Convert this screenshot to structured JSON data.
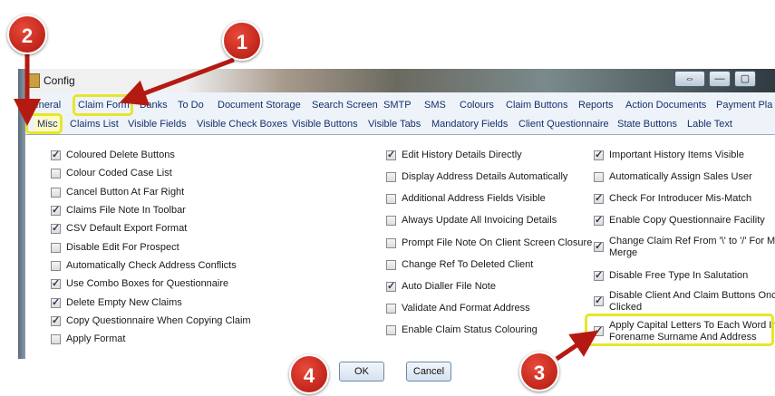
{
  "window": {
    "title": "Config",
    "restore_glyph": "⇔",
    "min_glyph": "—",
    "max_glyph": "▢"
  },
  "tabs_row1": [
    "General",
    "Claim Form",
    "Banks",
    "To Do",
    "Document Storage",
    "Search Screen",
    "SMTP",
    "SMS",
    "Colours",
    "Claim Buttons",
    "Reports",
    "Action Documents",
    "Payment Pla"
  ],
  "tabs_row2": [
    "Misc",
    "Claims List",
    "Visible Fields",
    "Visible Check Boxes",
    "Visible Buttons",
    "Visible Tabs",
    "Mandatory Fields",
    "Client Questionnaire",
    "State Buttons",
    "Lable Text"
  ],
  "col1": [
    {
      "label": "Coloured Delete Buttons",
      "checked": true
    },
    {
      "label": "Colour Coded Case List",
      "checked": false
    },
    {
      "label": "Cancel Button At Far Right",
      "checked": false
    },
    {
      "label": "Claims File Note In Toolbar",
      "checked": true
    },
    {
      "label": "CSV Default Export Format",
      "checked": true
    },
    {
      "label": "Disable Edit For Prospect",
      "checked": false
    },
    {
      "label": "Automatically Check Address Conflicts",
      "checked": false
    },
    {
      "label": "Use Combo Boxes for Questionnaire",
      "checked": true
    },
    {
      "label": "Delete Empty New Claims",
      "checked": true
    },
    {
      "label": "Copy Questionnaire When Copying Claim",
      "checked": true
    },
    {
      "label": "Apply Format",
      "checked": false
    }
  ],
  "col2": [
    {
      "label": "Edit History Details Directly",
      "checked": true
    },
    {
      "label": "Display Address Details Automatically",
      "checked": false
    },
    {
      "label": "Additional Address Fields Visible",
      "checked": false
    },
    {
      "label": "Always Update All Invoicing Details",
      "checked": false
    },
    {
      "label": "Prompt File Note On Client Screen Closure",
      "checked": false
    },
    {
      "label": "Change Ref To Deleted Client",
      "checked": false
    },
    {
      "label": "Auto Dialler File Note",
      "checked": true
    },
    {
      "label": "Validate And Format Address",
      "checked": false
    },
    {
      "label": "Enable Claim Status Colouring",
      "checked": false
    }
  ],
  "col3": [
    {
      "l1": "Important History Items Visible",
      "l2": "",
      "checked": true
    },
    {
      "l1": "Automatically Assign Sales User",
      "l2": "",
      "checked": false
    },
    {
      "l1": "Check For Introducer Mis-Match",
      "l2": "",
      "checked": true
    },
    {
      "l1": "Enable Copy Questionnaire Facility",
      "l2": "",
      "checked": true
    },
    {
      "l1": "Change Claim Ref  From  '\\' to '/' For Ma",
      "l2": "Merge",
      "checked": true
    },
    {
      "l1": "Disable Free Type In Salutation",
      "l2": "",
      "checked": true
    },
    {
      "l1": "Disable Client And Claim Buttons Once",
      "l2": "Clicked",
      "checked": true
    },
    {
      "l1": "Apply Capital Letters To Each Word In",
      "l2": "Forename Surname And Address",
      "checked": true
    }
  ],
  "buttons": {
    "ok": "OK",
    "cancel": "Cancel"
  },
  "callouts": {
    "c1": "1",
    "c2": "2",
    "c3": "3",
    "c4": "4"
  },
  "colors": {
    "highlight": "#e6e62a",
    "callout": "#c8251a",
    "tab_text": "#14306a"
  }
}
